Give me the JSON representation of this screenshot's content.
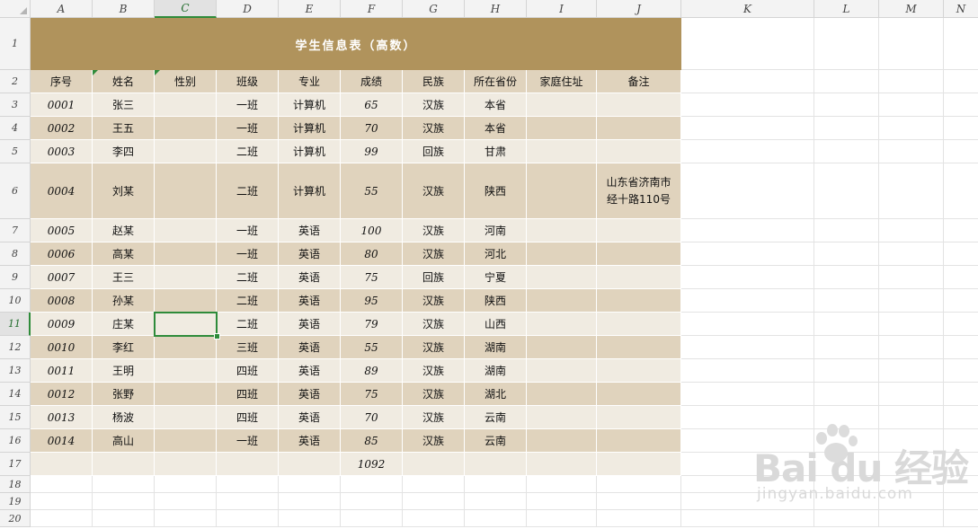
{
  "columns": [
    "A",
    "B",
    "C",
    "D",
    "E",
    "F",
    "G",
    "H",
    "I",
    "J",
    "K",
    "L",
    "M",
    "N"
  ],
  "rows": [
    "1",
    "2",
    "3",
    "4",
    "5",
    "6",
    "7",
    "8",
    "9",
    "10",
    "11",
    "12",
    "13",
    "14",
    "15",
    "16",
    "17",
    "18",
    "19",
    "20"
  ],
  "selected_cell": "C11",
  "table": {
    "title": "学生信息表（高数）",
    "headers": [
      "序号",
      "姓名",
      "性别",
      "班级",
      "专业",
      "成绩",
      "民族",
      "所在省份",
      "家庭住址",
      "备注"
    ],
    "records": [
      [
        "0001",
        "张三",
        "",
        "一班",
        "计算机",
        "65",
        "汉族",
        "本省",
        "",
        ""
      ],
      [
        "0002",
        "王五",
        "",
        "一班",
        "计算机",
        "70",
        "汉族",
        "本省",
        "",
        ""
      ],
      [
        "0003",
        "李四",
        "",
        "二班",
        "计算机",
        "99",
        "回族",
        "甘肃",
        "",
        ""
      ],
      [
        "0004",
        "刘某",
        "",
        "二班",
        "计算机",
        "55",
        "汉族",
        "陕西",
        "",
        "山东省济南市经十路110号"
      ],
      [
        "0005",
        "赵某",
        "",
        "一班",
        "英语",
        "100",
        "汉族",
        "河南",
        "",
        ""
      ],
      [
        "0006",
        "高某",
        "",
        "一班",
        "英语",
        "80",
        "汉族",
        "河北",
        "",
        ""
      ],
      [
        "0007",
        "王三",
        "",
        "二班",
        "英语",
        "75",
        "回族",
        "宁夏",
        "",
        ""
      ],
      [
        "0008",
        "孙某",
        "",
        "二班",
        "英语",
        "95",
        "汉族",
        "陕西",
        "",
        ""
      ],
      [
        "0009",
        "庄某",
        "",
        "二班",
        "英语",
        "79",
        "汉族",
        "山西",
        "",
        ""
      ],
      [
        "0010",
        "李红",
        "",
        "三班",
        "英语",
        "55",
        "汉族",
        "湖南",
        "",
        ""
      ],
      [
        "0011",
        "王明",
        "",
        "四班",
        "英语",
        "89",
        "汉族",
        "湖南",
        "",
        ""
      ],
      [
        "0012",
        "张野",
        "",
        "四班",
        "英语",
        "75",
        "汉族",
        "湖北",
        "",
        ""
      ],
      [
        "0013",
        "杨波",
        "",
        "四班",
        "英语",
        "70",
        "汉族",
        "云南",
        "",
        ""
      ],
      [
        "0014",
        "高山",
        "",
        "一班",
        "英语",
        "85",
        "汉族",
        "云南",
        "",
        ""
      ]
    ],
    "total": "1092"
  },
  "colors": {
    "title_bg": "#b0935c",
    "row_light": "#f0ebe1",
    "row_dark": "#e0d3bd",
    "selection": "#2e8b3a"
  },
  "watermark": {
    "logo": "Bai du 经验",
    "url": "jingyan.baidu.com"
  }
}
